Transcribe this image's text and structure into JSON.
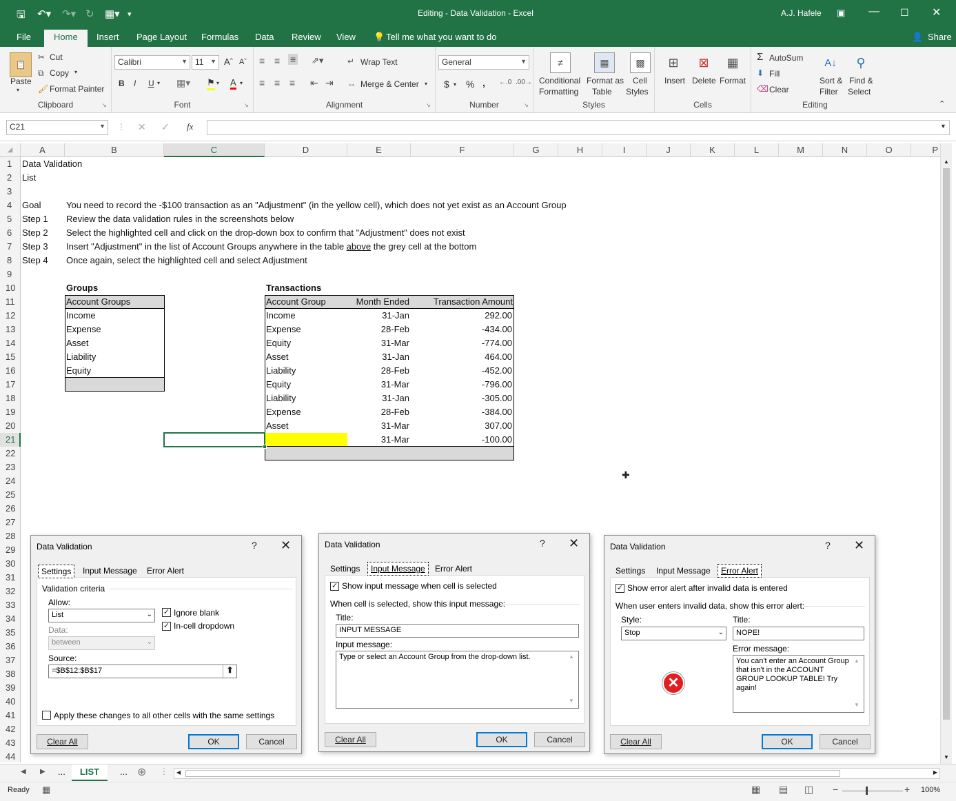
{
  "window": {
    "title": "Editing - Data Validation  -  Excel",
    "user": "A.J. Hafele"
  },
  "tabs": [
    "File",
    "Home",
    "Insert",
    "Page Layout",
    "Formulas",
    "Data",
    "Review",
    "View"
  ],
  "tell_me": "Tell me what you want to do",
  "share": "Share",
  "ribbon": {
    "clipboard": {
      "paste": "Paste",
      "cut": "Cut",
      "copy": "Copy",
      "format_painter": "Format Painter",
      "label": "Clipboard"
    },
    "font": {
      "name": "Calibri",
      "size": "11",
      "bold": "B",
      "italic": "I",
      "underline": "U",
      "label": "Font"
    },
    "alignment": {
      "wrap": "Wrap Text",
      "merge": "Merge & Center",
      "label": "Alignment"
    },
    "number": {
      "format": "General",
      "dollar": "$",
      "percent": "%",
      "comma": ",",
      "label": "Number"
    },
    "styles": {
      "conditional1": "Conditional",
      "conditional2": "Formatting",
      "fat1": "Format as",
      "fat2": "Table",
      "cs1": "Cell",
      "cs2": "Styles",
      "label": "Styles"
    },
    "cells": {
      "insert": "Insert",
      "delete": "Delete",
      "format": "Format",
      "label": "Cells"
    },
    "editing": {
      "autosum": "AutoSum",
      "fill": "Fill",
      "clear": "Clear",
      "sort1": "Sort &",
      "sort2": "Filter",
      "find1": "Find &",
      "find2": "Select",
      "label": "Editing"
    }
  },
  "namebox": "C21",
  "fx": "fx",
  "columns": [
    "A",
    "B",
    "C",
    "D",
    "E",
    "F",
    "G",
    "H",
    "I",
    "J",
    "K",
    "L",
    "M",
    "N",
    "O",
    "P"
  ],
  "rows": [
    "1",
    "2",
    "3",
    "4",
    "5",
    "6",
    "7",
    "8",
    "9",
    "10",
    "11",
    "12",
    "13",
    "14",
    "15",
    "16",
    "17",
    "18",
    "19",
    "20",
    "21",
    "22",
    "23",
    "24",
    "25",
    "26",
    "27",
    "28",
    "29",
    "30",
    "31",
    "32",
    "33",
    "34",
    "35",
    "36",
    "37",
    "38",
    "39",
    "40",
    "41",
    "42",
    "43",
    "44"
  ],
  "sheet": {
    "a1": "Data Validation",
    "a2": "List",
    "steps": [
      {
        "label": "Goal",
        "text": "You need to record the -$100 transaction as an \"Adjustment\" (in the yellow cell), which does not yet exist as an Account Group"
      },
      {
        "label": "Step 1",
        "text": "Review the data validation rules in the screenshots below"
      },
      {
        "label": "Step 2",
        "text": "Select the highlighted cell and click on the drop-down box to confirm that \"Adjustment\" does not exist"
      },
      {
        "label": "Step 3",
        "text_a": "Insert \"Adjustment\" in the list of Account Groups anywhere in the table ",
        "text_b": "above",
        "text_c": " the grey cell at the bottom"
      },
      {
        "label": "Step 4",
        "text": "Once again, select the highlighted cell and select Adjustment"
      }
    ],
    "groups_title": "Groups",
    "groups_header": "Account Groups",
    "groups": [
      "Income",
      "Expense",
      "Asset",
      "Liability",
      "Equity"
    ],
    "trans_title": "Transactions",
    "trans_headers": [
      "Account Group",
      "Month Ended",
      "Transaction Amount"
    ],
    "transactions": [
      [
        "Income",
        "31-Jan",
        "292.00"
      ],
      [
        "Expense",
        "28-Feb",
        "-434.00"
      ],
      [
        "Equity",
        "31-Mar",
        "-774.00"
      ],
      [
        "Asset",
        "31-Jan",
        "464.00"
      ],
      [
        "Liability",
        "28-Feb",
        "-452.00"
      ],
      [
        "Equity",
        "31-Mar",
        "-796.00"
      ],
      [
        "Liability",
        "31-Jan",
        "-305.00"
      ],
      [
        "Expense",
        "28-Feb",
        "-384.00"
      ],
      [
        "Asset",
        "31-Mar",
        "307.00"
      ],
      [
        "",
        "31-Mar",
        "-100.00"
      ]
    ],
    "highlight_color": "#ffff00",
    "grey_color": "#d9d9d9"
  },
  "dialog_settings": {
    "title": "Data Validation",
    "q": "?",
    "x": "✕",
    "tabs": [
      "Settings",
      "Input Message",
      "Error Alert"
    ],
    "criteria": "Validation criteria",
    "allow_label": "Allow:",
    "allow": "List",
    "ignore_blank": "Ignore blank",
    "in_cell": "In-cell dropdown",
    "data_label": "Data:",
    "data": "between",
    "source_label": "Source:",
    "source": "=$B$12:$B$17",
    "apply": "Apply these changes to all other cells with the same settings",
    "clear": "Clear All",
    "ok": "OK",
    "cancel": "Cancel"
  },
  "dialog_input": {
    "title": "Data Validation",
    "q": "?",
    "x": "✕",
    "tabs": [
      "Settings",
      "Input Message",
      "Error Alert"
    ],
    "show": "Show input message when cell is selected",
    "when": "When cell is selected, show this input message:",
    "title_label": "Title:",
    "title_value": "INPUT MESSAGE",
    "msg_label": "Input message:",
    "msg": "Type or select an Account Group from the drop-down list.",
    "clear": "Clear All",
    "ok": "OK",
    "cancel": "Cancel"
  },
  "dialog_error": {
    "title": "Data Validation",
    "q": "?",
    "x": "✕",
    "tabs": [
      "Settings",
      "Input Message",
      "Error Alert"
    ],
    "show": "Show error alert after invalid data is entered",
    "when": "When user enters invalid data, show this error alert:",
    "style_label": "Style:",
    "style": "Stop",
    "title_label": "Title:",
    "title_value": "NOPE!",
    "msg_label": "Error message:",
    "msg": "You can't enter an Account Group that isn't in the ACCOUNT GROUP LOOKUP TABLE!  Try again!",
    "clear": "Clear All",
    "ok": "OK",
    "cancel": "Cancel"
  },
  "sheet_tab": "LIST",
  "status": {
    "ready": "Ready",
    "zoom": "100%"
  }
}
